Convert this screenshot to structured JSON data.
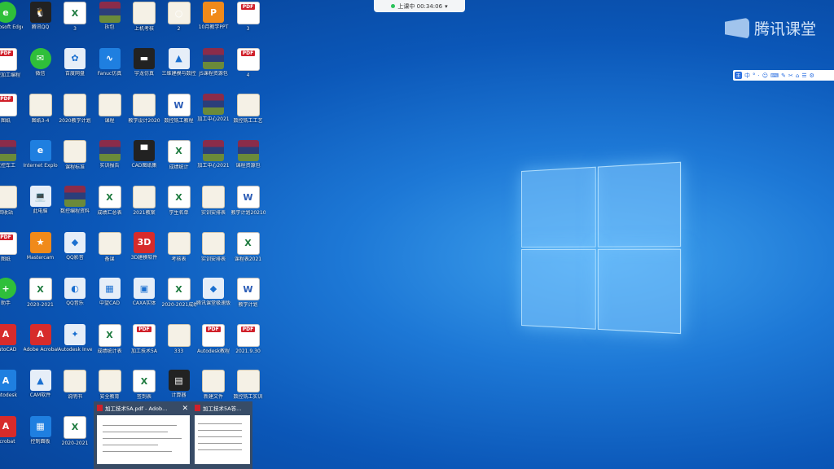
{
  "recording": {
    "status": "上课中 00:34:06",
    "dropdown": "▾"
  },
  "brand": {
    "name": "腾讯课堂"
  },
  "ime": {
    "badge": "王",
    "items": [
      "中",
      "°",
      "·",
      "☺",
      "⌨",
      "✎",
      "✂",
      "⌂",
      "☰",
      "⚙"
    ]
  },
  "desktop_icons": [
    {
      "type": "green",
      "glyph": "e",
      "label": "Microsoft Edge"
    },
    {
      "type": "dark",
      "glyph": "🐧",
      "label": "腾讯QQ"
    },
    {
      "type": "xls",
      "glyph": "X",
      "label": "3"
    },
    {
      "type": "rar",
      "glyph": "",
      "label": "拆包"
    },
    {
      "type": "doc",
      "glyph": "",
      "label": "上机考核"
    },
    {
      "type": "doc",
      "glyph": "○",
      "label": "2"
    },
    {
      "type": "orange",
      "glyph": "P",
      "label": "10月教学PPT"
    },
    {
      "type": "pdf",
      "glyph": "",
      "label": "3"
    },
    {
      "type": "pdf",
      "glyph": "",
      "label": "数控加工编程"
    },
    {
      "type": "green",
      "glyph": "✉",
      "label": "微信"
    },
    {
      "type": "app",
      "glyph": "✿",
      "label": "百度网盘"
    },
    {
      "type": "blue",
      "glyph": "∿",
      "label": "Fanuc仿真"
    },
    {
      "type": "dark",
      "glyph": "▬",
      "label": "宇龙仿真"
    },
    {
      "type": "app",
      "glyph": "▲",
      "label": "三维建模与数控加工"
    },
    {
      "type": "rar",
      "glyph": "",
      "label": "JS课程资源包"
    },
    {
      "type": "pdf",
      "glyph": "",
      "label": "4"
    },
    {
      "type": "pdf",
      "glyph": "",
      "label": "图纸"
    },
    {
      "type": "doc",
      "glyph": "",
      "label": "图纸3-4"
    },
    {
      "type": "doc",
      "glyph": "",
      "label": "2020教学计划"
    },
    {
      "type": "doc",
      "glyph": "",
      "label": "课程"
    },
    {
      "type": "doc",
      "glyph": "",
      "label": "教学设计2020"
    },
    {
      "type": "word",
      "glyph": "W",
      "label": "数控铣工教程"
    },
    {
      "type": "rar",
      "glyph": "",
      "label": "加工中心2021"
    },
    {
      "type": "doc",
      "glyph": "",
      "label": "数控铣工工艺"
    },
    {
      "type": "rar",
      "glyph": "",
      "label": "数控车工"
    },
    {
      "type": "blue",
      "glyph": "e",
      "label": "Internet Explorer"
    },
    {
      "type": "doc",
      "glyph": "",
      "label": "课程标准"
    },
    {
      "type": "rar",
      "glyph": "",
      "label": "实训报告"
    },
    {
      "type": "dark",
      "glyph": "▀",
      "label": "CAD图纸集"
    },
    {
      "type": "xls",
      "glyph": "X",
      "label": "成绩统计"
    },
    {
      "type": "rar",
      "glyph": "",
      "label": "加工中心2021"
    },
    {
      "type": "rar",
      "glyph": "",
      "label": "课程资源包"
    },
    {
      "type": "doc",
      "glyph": "",
      "label": "回收站"
    },
    {
      "type": "app",
      "glyph": "💻",
      "label": "此电脑"
    },
    {
      "type": "rar",
      "glyph": "",
      "label": "数控编程资料"
    },
    {
      "type": "xls",
      "glyph": "X",
      "label": "成绩汇总表"
    },
    {
      "type": "doc",
      "glyph": "",
      "label": "2021教案"
    },
    {
      "type": "xls",
      "glyph": "X",
      "label": "学生名单"
    },
    {
      "type": "doc",
      "glyph": "",
      "label": "实训安排表"
    },
    {
      "type": "word",
      "glyph": "W",
      "label": "教学计划20210927"
    },
    {
      "type": "pdf",
      "glyph": "",
      "label": "图纸"
    },
    {
      "type": "orange",
      "glyph": "★",
      "label": "Mastercam"
    },
    {
      "type": "app",
      "glyph": "◆",
      "label": "QQ影音"
    },
    {
      "type": "doc",
      "glyph": "",
      "label": "备课"
    },
    {
      "type": "red",
      "glyph": "3D",
      "label": "3D建模软件"
    },
    {
      "type": "doc",
      "glyph": "",
      "label": "考核表"
    },
    {
      "type": "doc",
      "glyph": "",
      "label": "实训安排表"
    },
    {
      "type": "xls",
      "glyph": "X",
      "label": "课程表2021"
    },
    {
      "type": "green",
      "glyph": "+",
      "label": "助手"
    },
    {
      "type": "xls",
      "glyph": "X",
      "label": "2020-2021"
    },
    {
      "type": "app",
      "glyph": "◐",
      "label": "QQ音乐"
    },
    {
      "type": "app",
      "glyph": "▦",
      "label": "中望CAD"
    },
    {
      "type": "app",
      "glyph": "▣",
      "label": "CAXA实体"
    },
    {
      "type": "xls",
      "glyph": "X",
      "label": "2020-2021成绩"
    },
    {
      "type": "app",
      "glyph": "◆",
      "label": "腾讯课堂极速版"
    },
    {
      "type": "word",
      "glyph": "W",
      "label": "教学计划"
    },
    {
      "type": "red",
      "glyph": "A",
      "label": "AutoCAD"
    },
    {
      "type": "red",
      "glyph": "A",
      "label": "Adobe Acrobat"
    },
    {
      "type": "app",
      "glyph": "✦",
      "label": "Autodesk Inventor"
    },
    {
      "type": "xls",
      "glyph": "X",
      "label": "成绩统计表"
    },
    {
      "type": "pdf",
      "glyph": "",
      "label": "加工技术5A"
    },
    {
      "type": "doc",
      "glyph": "",
      "label": "333"
    },
    {
      "type": "pdf",
      "glyph": "",
      "label": "Autodesk教程"
    },
    {
      "type": "pdf",
      "glyph": "",
      "label": "2021.9.30"
    },
    {
      "type": "blue",
      "glyph": "A",
      "label": "Autodesk"
    },
    {
      "type": "app",
      "glyph": "▲",
      "label": "CAM软件"
    },
    {
      "type": "doc",
      "glyph": "",
      "label": "说明书"
    },
    {
      "type": "doc",
      "glyph": "",
      "label": "安全教育"
    },
    {
      "type": "xls",
      "glyph": "X",
      "label": "签到表"
    },
    {
      "type": "dark",
      "glyph": "▤",
      "label": "计算器"
    },
    {
      "type": "doc",
      "glyph": "",
      "label": "新建文件"
    },
    {
      "type": "doc",
      "glyph": "",
      "label": "数控铣工实训"
    },
    {
      "type": "red",
      "glyph": "A",
      "label": "Acrobat"
    },
    {
      "type": "blue",
      "glyph": "▦",
      "label": "控制面板"
    },
    {
      "type": "xls",
      "glyph": "X",
      "label": "2020-2021"
    }
  ],
  "thumbnails": {
    "items": [
      {
        "title": "加工技术5A.pdf - Adob..."
      },
      {
        "title": "加工技术5A答..."
      }
    ],
    "close": "✕"
  }
}
